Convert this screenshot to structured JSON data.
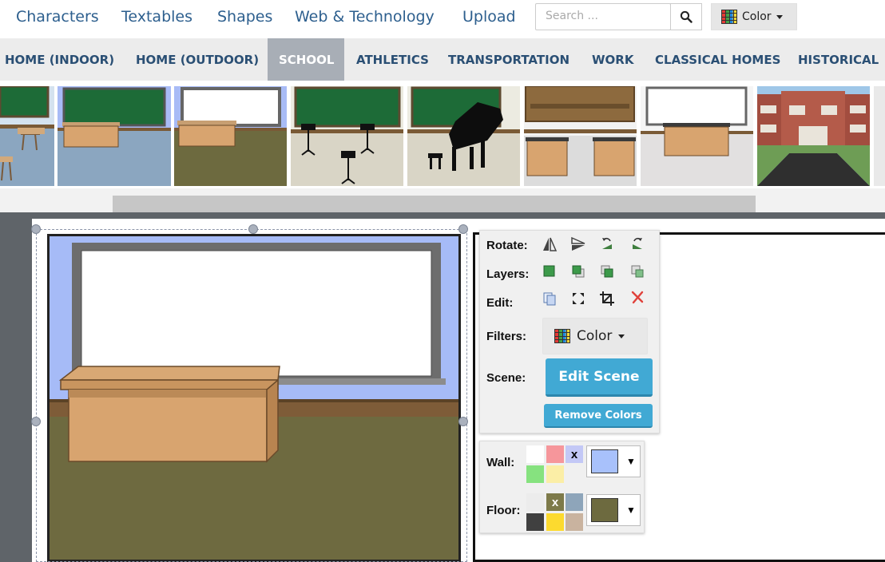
{
  "nav": {
    "links": [
      "Characters",
      "Textables",
      "Shapes",
      "Web & Technology",
      "Upload"
    ],
    "search_placeholder": "Search ...",
    "color_label": "Color"
  },
  "categories": {
    "items": [
      "HOME (INDOOR)",
      "HOME (OUTDOOR)",
      "SCHOOL",
      "ATHLETICS",
      "TRANSPORTATION",
      "WORK",
      "CLASSICAL HOMES",
      "HISTORICAL"
    ],
    "active": "SCHOOL"
  },
  "tools": {
    "rotate_label": "Rotate:",
    "layers_label": "Layers:",
    "edit_label": "Edit:",
    "filters_label": "Filters:",
    "filter_value": "Color",
    "scene_label": "Scene:",
    "edit_scene_button": "Edit Scene",
    "remove_colors_button": "Remove Colors"
  },
  "colors": {
    "wall_label": "Wall:",
    "floor_label": "Floor:",
    "swatch_x": "x",
    "wall_swatches": [
      "#ffffff",
      "#f6969b",
      "#c3c8f6",
      "#86e27f",
      "#fbeea6"
    ],
    "floor_swatches": [
      "#ececec",
      "#7d7a4a",
      "#8ea5ba",
      "#404040",
      "#fcda2f",
      "#c9b39f"
    ],
    "wall_current": "#a8c1fb",
    "floor_current": "#6d6a3f"
  },
  "theme": {
    "link_color": "#2d5f8e",
    "category_color": "#2a4f74",
    "button_blue": "#41a9d4"
  }
}
